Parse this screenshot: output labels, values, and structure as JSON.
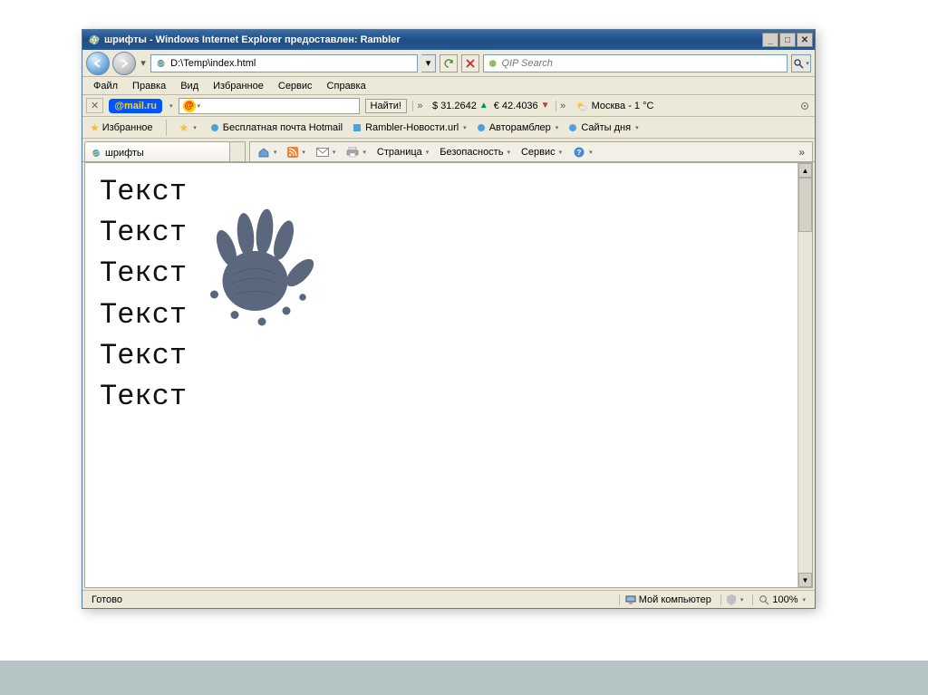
{
  "window": {
    "title": "шрифты - Windows Internet Explorer предоставлен: Rambler"
  },
  "nav": {
    "address": "D:\\Temp\\index.html",
    "search_placeholder": "QIP Search"
  },
  "menu": {
    "file": "Файл",
    "edit": "Правка",
    "view": "Вид",
    "favorites": "Избранное",
    "tools": "Сервис",
    "help": "Справка"
  },
  "mailbar": {
    "logo": "@mail.ru",
    "find": "Найти!",
    "usd_label": "$",
    "usd_value": "31.2642",
    "usd_arrow": "▲",
    "eur_label": "€",
    "eur_value": "42.4036",
    "eur_arrow": "▼",
    "weather_label": "Москва - 1 °C"
  },
  "links": {
    "favorites": "Избранное",
    "hotmail": "Бесплатная почта Hotmail",
    "rambler": "Rambler-Новости.url",
    "autorambler": "Авторамблер",
    "sites": "Сайты дня"
  },
  "tabs": {
    "active": "шрифты"
  },
  "cmdbar": {
    "page": "Страница",
    "security": "Безопасность",
    "service": "Сервис"
  },
  "page": {
    "line1": "Текст",
    "line2": "Текст",
    "line3": "Текст",
    "line4": "Текст",
    "line5": "Текст",
    "line6": "Текст"
  },
  "status": {
    "ready": "Готово",
    "zone": "Мой компьютер",
    "zoom": "100%"
  }
}
